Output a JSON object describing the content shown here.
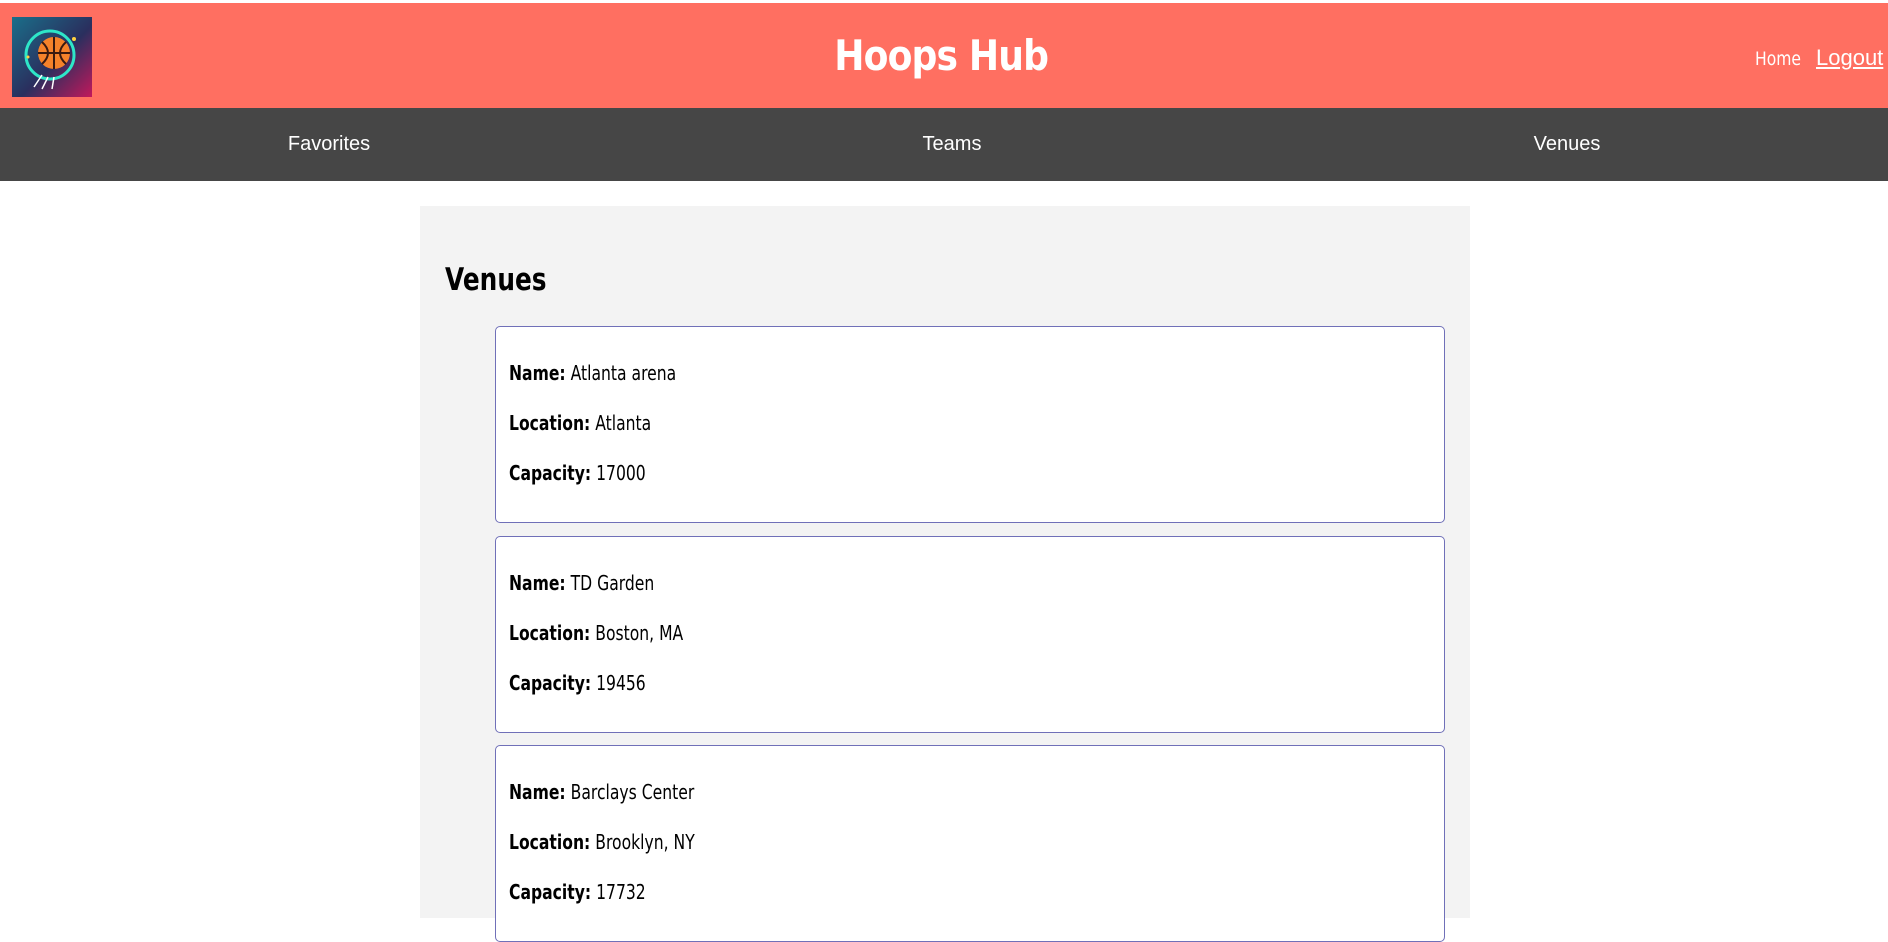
{
  "header": {
    "title": "Hoops Hub",
    "home_label": "Home",
    "logout_label": "Logout",
    "logo_icon": "basketball-logo-icon"
  },
  "nav": {
    "items": [
      {
        "label": "Favorites"
      },
      {
        "label": "Teams"
      },
      {
        "label": "Venues"
      }
    ]
  },
  "main": {
    "title": "Venues",
    "field_labels": {
      "name": "Name:",
      "location": "Location:",
      "capacity": "Capacity:"
    },
    "venues": [
      {
        "name": "Atlanta arena",
        "location": "Atlanta",
        "capacity": "17000"
      },
      {
        "name": "TD Garden",
        "location": "Boston, MA",
        "capacity": "19456"
      },
      {
        "name": "Barclays Center",
        "location": "Brooklyn, NY",
        "capacity": "17732"
      }
    ]
  },
  "colors": {
    "header_bg": "#ff6f61",
    "nav_bg": "#464646",
    "panel_bg": "#f3f3f3",
    "card_border": "#7070b8"
  }
}
